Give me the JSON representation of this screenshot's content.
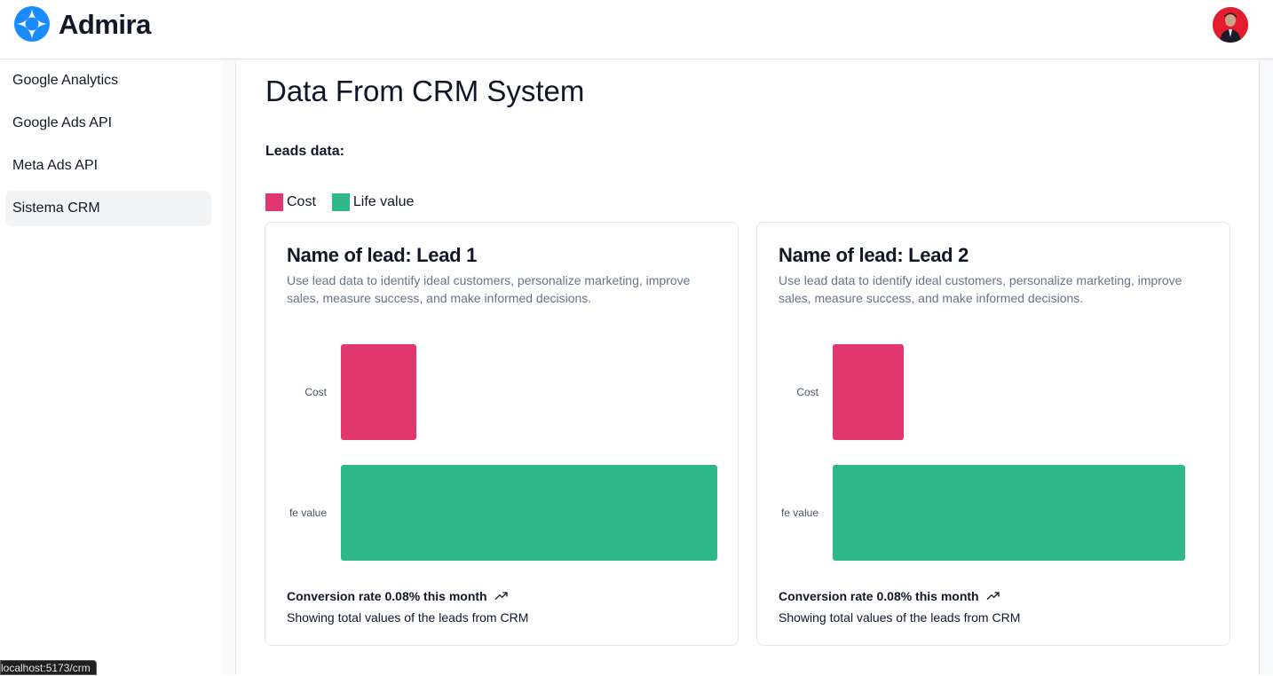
{
  "app": {
    "brand": "Admira",
    "logo_icon": "admira-logo-icon",
    "avatar_icon": "user-avatar"
  },
  "sidebar": {
    "items": [
      {
        "label": "Google Analytics",
        "active": false
      },
      {
        "label": "Google Ads API",
        "active": false
      },
      {
        "label": "Meta Ads API",
        "active": false
      },
      {
        "label": "Sistema CRM",
        "active": true
      }
    ]
  },
  "main": {
    "title": "Data From CRM System",
    "leads_label": "Leads data:",
    "legend": [
      {
        "label": "Cost",
        "color": "#e2366f"
      },
      {
        "label": "Life value",
        "color": "#2eb88a"
      }
    ]
  },
  "cards": [
    {
      "title": "Name of lead: Lead 1",
      "description": "Use lead data to identify ideal customers, personalize marketing, improve sales, measure success, and make informed decisions.",
      "conversion": "Conversion rate 0.08% this month",
      "trend_icon": "trending-up-icon",
      "footer": "Showing total values of the leads from CRM"
    },
    {
      "title": "Name of lead: Lead 2",
      "description": "Use lead data to identify ideal customers, personalize marketing, improve sales, measure success, and make informed decisions.",
      "conversion": "Conversion rate 0.08% this month",
      "trend_icon": "trending-up-icon",
      "footer": "Showing total values of the leads from CRM"
    }
  ],
  "chart_data": [
    {
      "type": "bar",
      "orientation": "horizontal",
      "categories": [
        "Cost",
        "fe value"
      ],
      "series": [
        {
          "values": [
            20,
            100
          ]
        }
      ],
      "colors": [
        "#e2366f",
        "#2eb88a"
      ],
      "xlim": [
        0,
        100
      ]
    },
    {
      "type": "bar",
      "orientation": "horizontal",
      "categories": [
        "Cost",
        "fe value"
      ],
      "series": [
        {
          "values": [
            20,
            100
          ]
        }
      ],
      "colors": [
        "#e2366f",
        "#2eb88a"
      ],
      "xlim": [
        0,
        100
      ]
    }
  ],
  "status_bar": {
    "url": "localhost:5173/crm"
  }
}
